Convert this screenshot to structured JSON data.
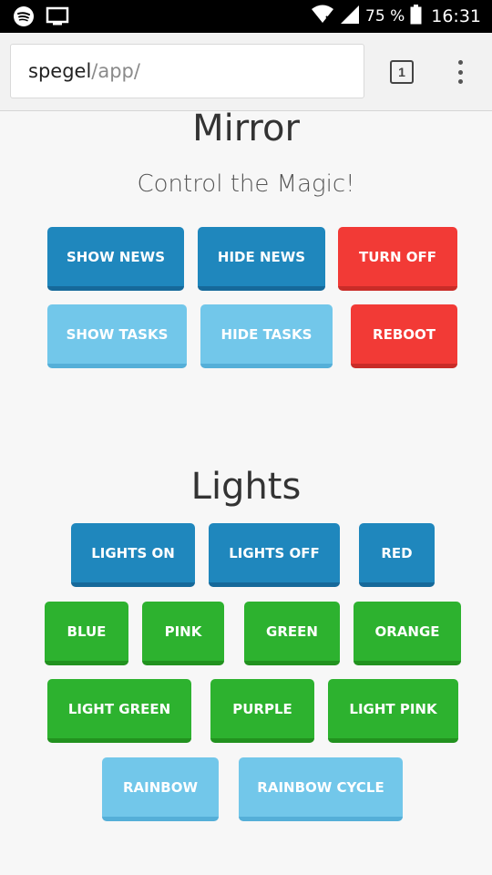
{
  "status_bar": {
    "battery": "75 %",
    "time": "16:31",
    "icons": [
      "spotify-icon",
      "cast-icon",
      "wifi-icon",
      "signal-icon",
      "battery-icon"
    ]
  },
  "browser": {
    "url_host": "spegel",
    "url_path": "/app/",
    "tab_count": "1"
  },
  "mirror": {
    "title": "Mirror",
    "subtitle": "Control the Magic!",
    "buttons": {
      "show_news": "SHOW NEWS",
      "hide_news": "HIDE NEWS",
      "turn_off": "TURN OFF",
      "show_tasks": "SHOW TASKS",
      "hide_tasks": "HIDE TASKS",
      "reboot": "REBOOT"
    }
  },
  "lights": {
    "title": "Lights",
    "buttons": {
      "lights_on": "LIGHTS ON",
      "lights_off": "LIGHTS OFF",
      "red": "RED",
      "blue": "BLUE",
      "pink": "PINK",
      "green": "GREEN",
      "orange": "ORANGE",
      "light_green": "LIGHT GREEN",
      "purple": "PURPLE",
      "light_pink": "LIGHT PINK",
      "rainbow": "RAINBOW",
      "rainbow_cycle": "RAINBOW CYCLE"
    }
  },
  "colors": {
    "dark_blue": "#1f87bd",
    "light_blue": "#72c7ea",
    "red": "#f23a36",
    "green": "#2db22f"
  }
}
